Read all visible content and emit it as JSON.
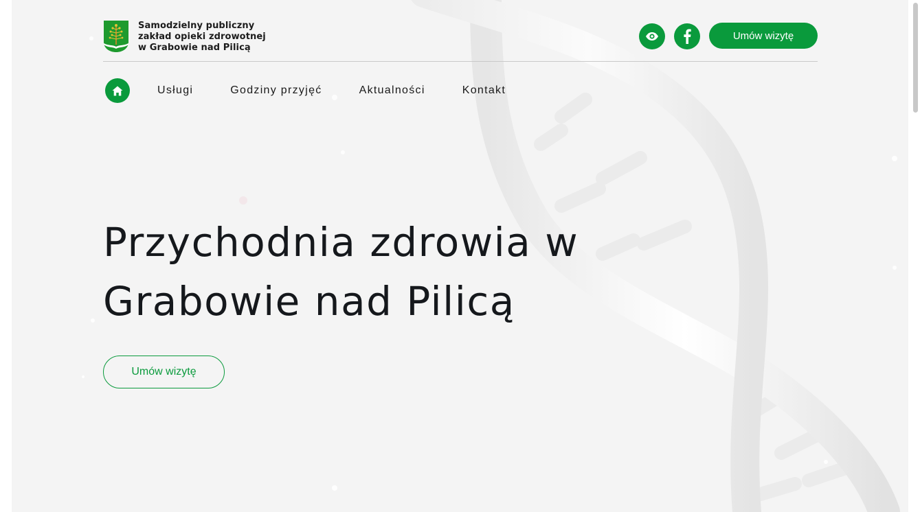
{
  "logo": {
    "lines": [
      "Samodzielny publiczny",
      "zakład opieki zdrowotnej",
      "w Grabowie nad Pilicą"
    ]
  },
  "header": {
    "accessibility_icon": "eye-icon",
    "social_icon": "facebook-icon",
    "book_label": "Umów wizytę"
  },
  "nav": {
    "home_icon": "home-icon",
    "items": [
      "Usługi",
      "Godziny przyjęć",
      "Aktualności",
      "Kontakt"
    ]
  },
  "hero": {
    "title": "Przychodnia zdrowia w Grabowie nad Pilicą",
    "button_label": "Umów wizytę"
  },
  "colors": {
    "accent": "#0a9a3c",
    "background": "#f4f4f4",
    "text": "#15181c"
  }
}
